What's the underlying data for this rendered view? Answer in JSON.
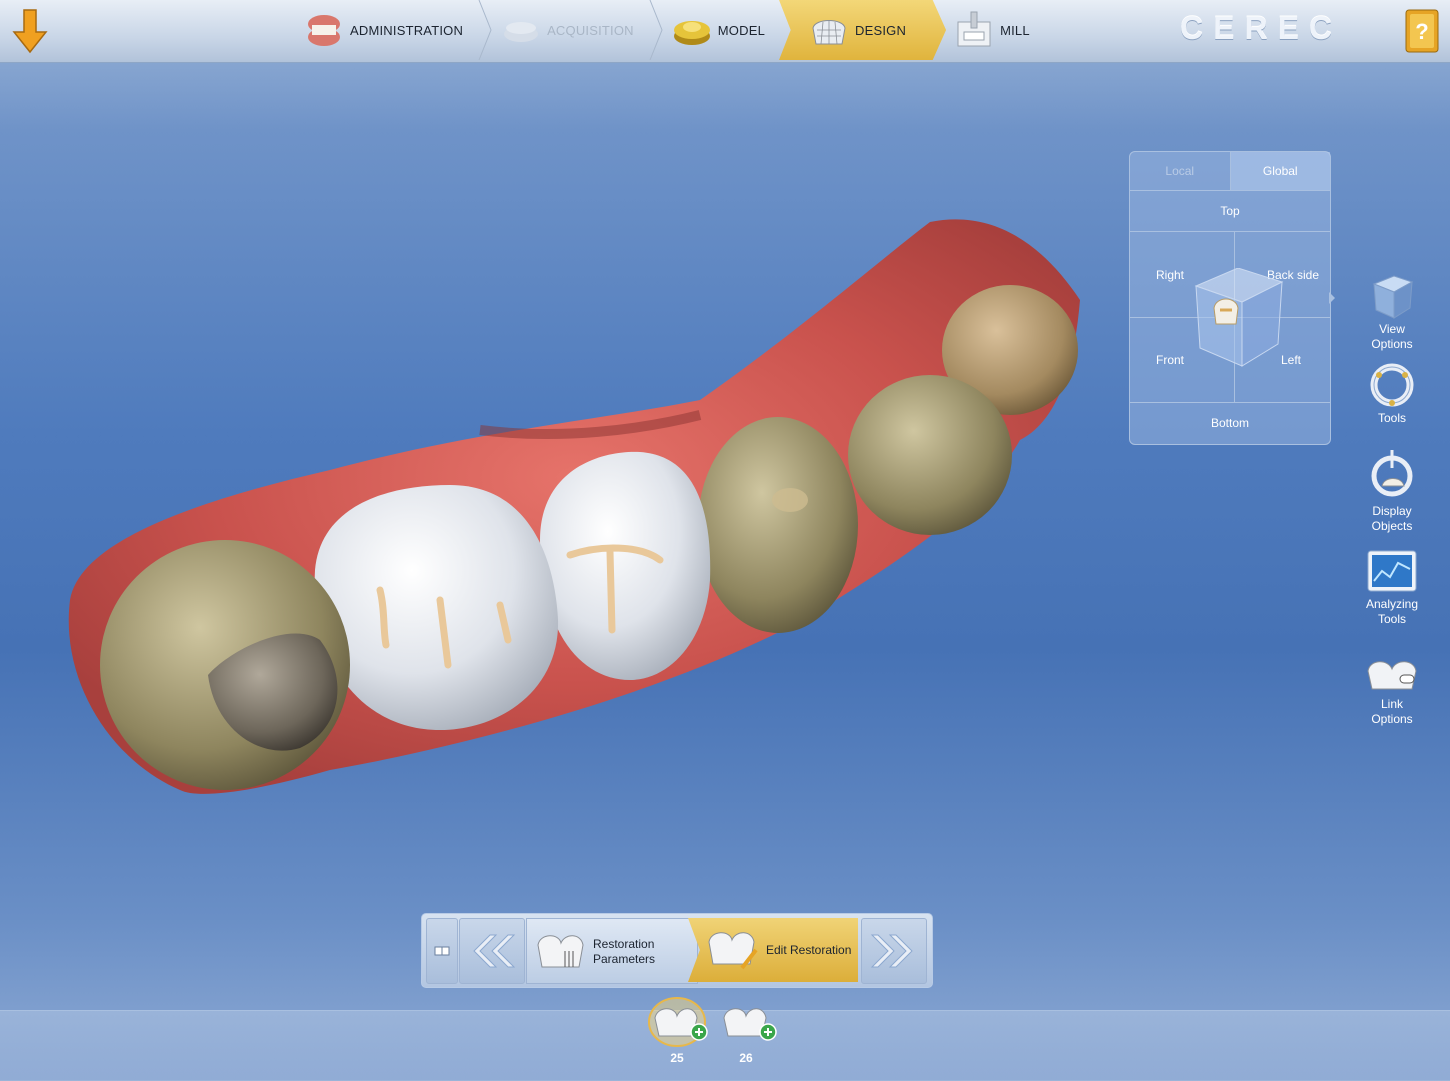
{
  "header": {
    "brand": "CEREC",
    "workflow": [
      {
        "label": "ADMINISTRATION",
        "state": "normal",
        "icon": "dentures-icon"
      },
      {
        "label": "ACQUISITION",
        "state": "disabled",
        "icon": "scan-icon"
      },
      {
        "label": "MODEL",
        "state": "normal",
        "icon": "model-icon"
      },
      {
        "label": "DESIGN",
        "state": "active",
        "icon": "crown-mesh-icon"
      },
      {
        "label": "MILL",
        "state": "normal",
        "icon": "milling-unit-icon"
      }
    ]
  },
  "view_panel": {
    "tabs": {
      "local": "Local",
      "global": "Global"
    },
    "top": "Top",
    "right": "Right",
    "back_side": "Back side",
    "front": "Front",
    "left": "Left",
    "bottom": "Bottom"
  },
  "tools": [
    {
      "label1": "View",
      "label2": "Options"
    },
    {
      "label1": "Tools",
      "label2": ""
    },
    {
      "label1": "Display",
      "label2": "Objects"
    },
    {
      "label1": "Analyzing",
      "label2": "Tools"
    },
    {
      "label1": "Link",
      "label2": "Options"
    }
  ],
  "phase_bar": {
    "params_line1": "Restoration",
    "params_line2": "Parameters",
    "edit": "Edit Restoration"
  },
  "tooth_tabs": [
    {
      "number": "25",
      "selected": true
    },
    {
      "number": "26",
      "selected": false
    }
  ],
  "colors": {
    "accent": "#e0b43d",
    "panel_border": "#a9c0e0",
    "background": "#4f7bbd"
  }
}
